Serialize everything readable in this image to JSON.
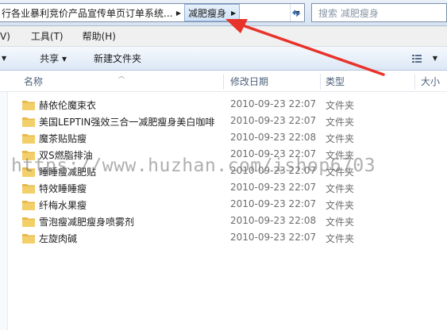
{
  "address_bar": {
    "root_crumb": "行各业暴利竞价产品宣传单页订单系统...",
    "current_folder": "减肥瘦身"
  },
  "search": {
    "placeholder": "搜索 减肥瘦身"
  },
  "menubar": {
    "items": [
      {
        "label": "V)"
      },
      {
        "label": "工具(T)"
      },
      {
        "label": "帮助(H)"
      }
    ]
  },
  "toolbar": {
    "share_label": "共享 ▾",
    "new_folder_label": "新建文件夹"
  },
  "columns": {
    "name": "名称",
    "date": "修改日期",
    "type": "类型",
    "size": "大小"
  },
  "files": [
    {
      "name": "赫依伦魔束衣",
      "date": "2010-09-23 22:07",
      "type": "文件夹"
    },
    {
      "name": "美国LEPTIN强效三合一减肥瘦身美白咖啡",
      "date": "2010-09-23 22:07",
      "type": "文件夹"
    },
    {
      "name": "魔茶贴贴瘦",
      "date": "2010-09-23 22:08",
      "type": "文件夹"
    },
    {
      "name": "双S燃脂排油",
      "date": "2010-09-23 22:07",
      "type": "文件夹"
    },
    {
      "name": "睡睡瘦减肥贴",
      "date": "2010-09-23 22:07",
      "type": "文件夹"
    },
    {
      "name": "特效睡睡瘦",
      "date": "2010-09-23 22:07",
      "type": "文件夹"
    },
    {
      "name": "纤梅水果瘦",
      "date": "2010-09-23 22:07",
      "type": "文件夹"
    },
    {
      "name": "雪泡瘦减肥瘦身喷雾剂",
      "date": "2010-09-23 22:08",
      "type": "文件夹"
    },
    {
      "name": "左旋肉碱",
      "date": "2010-09-23 22:07",
      "type": "文件夹"
    }
  ],
  "watermark": {
    "text": "https://www.huzhan.com/ishop6703"
  },
  "colors": {
    "annotation_arrow": "#e8322a",
    "folder": "#e8b94a"
  }
}
